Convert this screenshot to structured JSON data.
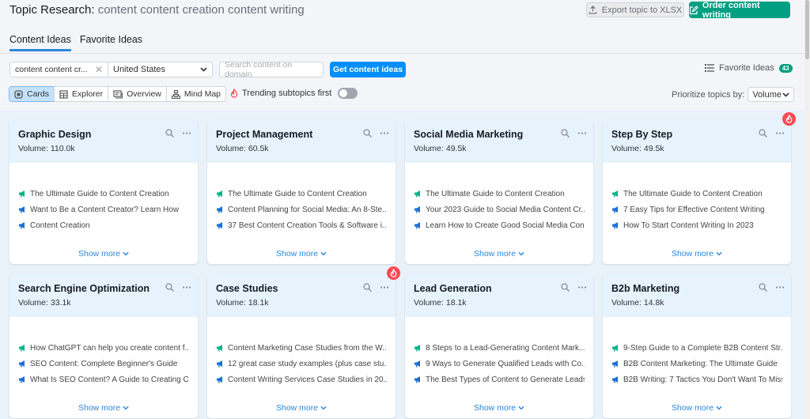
{
  "header": {
    "title_prefix": "Topic Research:",
    "title_query": "content content creation content writing",
    "export_label": "Export topic to XLSX",
    "order_label": "Order content writing"
  },
  "tabs": [
    {
      "label": "Content Ideas",
      "active": true
    },
    {
      "label": "Favorite Ideas",
      "active": false
    }
  ],
  "filters": {
    "query_value": "content content cr...",
    "country_value": "United States",
    "domain_placeholder": "Search content on domain",
    "get_ideas_label": "Get content ideas",
    "favorite_ideas_label": "Favorite Ideas",
    "favorite_ideas_count": "43"
  },
  "views": [
    {
      "label": "Cards",
      "icon": "cards-icon",
      "active": true
    },
    {
      "label": "Explorer",
      "icon": "table-icon",
      "active": false
    },
    {
      "label": "Overview",
      "icon": "overview-icon",
      "active": false
    },
    {
      "label": "Mind Map",
      "icon": "mindmap-icon",
      "active": false
    }
  ],
  "trending": {
    "label": "Trending subtopics first",
    "enabled": false
  },
  "prioritize": {
    "label": "Prioritize topics by:",
    "value": "Volume"
  },
  "colors": {
    "accent_blue": "#008ff8",
    "accent_green": "#009f81",
    "hot_red": "#ff4953",
    "headline_green": "#00b487",
    "headline_blue": "#1a6fd6"
  },
  "cards": [
    {
      "title": "Graphic Design",
      "volume": "Volume: 110.0k",
      "hot": false,
      "ideas": [
        {
          "text": "The Ultimate Guide to Content Creation",
          "type": "green"
        },
        {
          "text": "Want to Be a Content Creator? Learn How",
          "type": "blue"
        },
        {
          "text": "Content Creation",
          "type": "blue"
        }
      ],
      "show_more": "Show more"
    },
    {
      "title": "Project Management",
      "volume": "Volume: 60.5k",
      "hot": false,
      "ideas": [
        {
          "text": "The Ultimate Guide to Content Creation",
          "type": "green"
        },
        {
          "text": "Content Planning for Social Media: An 8-Ste...",
          "type": "blue"
        },
        {
          "text": "37 Best Content Creation Tools & Software i...",
          "type": "blue"
        }
      ],
      "show_more": "Show more"
    },
    {
      "title": "Social Media Marketing",
      "volume": "Volume: 49.5k",
      "hot": false,
      "ideas": [
        {
          "text": "The Ultimate Guide to Content Creation",
          "type": "green"
        },
        {
          "text": "Your 2023 Guide to Social Media Content Cr...",
          "type": "blue"
        },
        {
          "text": "Learn How to Create Good Social Media Con...",
          "type": "blue"
        }
      ],
      "show_more": "Show more"
    },
    {
      "title": "Step By Step",
      "volume": "Volume: 49.5k",
      "hot": true,
      "ideas": [
        {
          "text": "The Ultimate Guide to Content Creation",
          "type": "green"
        },
        {
          "text": "7 Easy Tips for Effective Content Writing",
          "type": "blue"
        },
        {
          "text": "How To Start Content Writing In 2023",
          "type": "blue"
        }
      ],
      "show_more": "Show more"
    },
    {
      "title": "Search Engine Optimization",
      "volume": "Volume: 33.1k",
      "hot": false,
      "ideas": [
        {
          "text": "How ChatGPT can help you create content f...",
          "type": "green"
        },
        {
          "text": "SEO Content: Complete Beginner's Guide",
          "type": "blue"
        },
        {
          "text": "What Is SEO Content? A Guide to Creating C...",
          "type": "blue"
        }
      ],
      "show_more": "Show more"
    },
    {
      "title": "Case Studies",
      "volume": "Volume: 18.1k",
      "hot": true,
      "ideas": [
        {
          "text": "Content Marketing Case Studies from the W...",
          "type": "green"
        },
        {
          "text": "12 great case study examples (plus case stu...",
          "type": "blue"
        },
        {
          "text": "Content Writing Services Case Studies in 20...",
          "type": "blue"
        }
      ],
      "show_more": "Show more"
    },
    {
      "title": "Lead Generation",
      "volume": "Volume: 18.1k",
      "hot": false,
      "ideas": [
        {
          "text": "8 Steps to a Lead-Generating Content Mark...",
          "type": "green"
        },
        {
          "text": "9 Ways to Generate Qualified Leads with Co...",
          "type": "blue"
        },
        {
          "text": "The Best Types of Content to Generate Leads",
          "type": "blue"
        }
      ],
      "show_more": "Show more"
    },
    {
      "title": "B2b Marketing",
      "volume": "Volume: 14.8k",
      "hot": false,
      "ideas": [
        {
          "text": "9-Step Guide to a Complete B2B Content Str...",
          "type": "green"
        },
        {
          "text": "B2B Content Marketing: The Ultimate Guide",
          "type": "blue"
        },
        {
          "text": "B2B Writing: 7 Tactics You Don't Want To Miss",
          "type": "blue"
        }
      ],
      "show_more": "Show more"
    }
  ]
}
